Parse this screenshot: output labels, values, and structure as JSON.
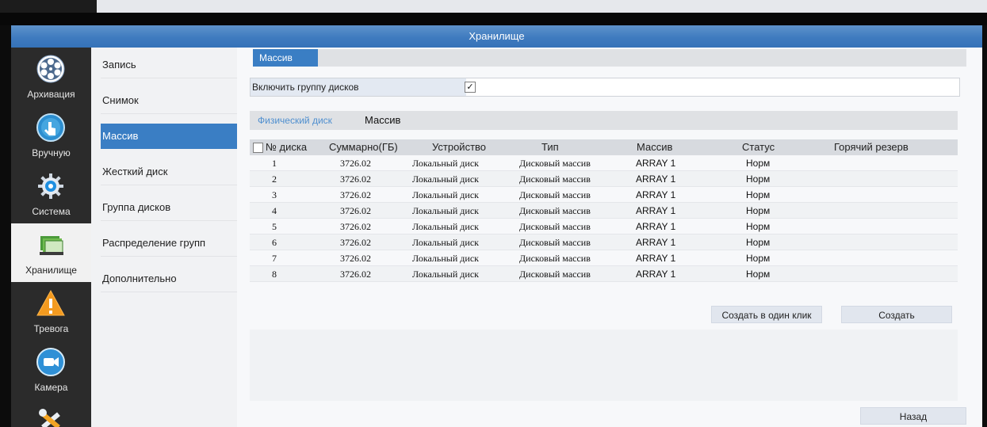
{
  "window": {
    "title": "Хранилище"
  },
  "left_nav": {
    "items": [
      {
        "id": "archive",
        "label": "Архивация",
        "icon": "film-reel-icon"
      },
      {
        "id": "manual",
        "label": "Вручную",
        "icon": "hand-pointer-icon"
      },
      {
        "id": "system",
        "label": "Система",
        "icon": "gear-icon"
      },
      {
        "id": "storage",
        "label": "Хранилище",
        "icon": "storage-folder-icon",
        "active": true
      },
      {
        "id": "alarm",
        "label": "Тревога",
        "icon": "warning-icon"
      },
      {
        "id": "camera",
        "label": "Камера",
        "icon": "camera-icon"
      },
      {
        "id": "tools",
        "label": "",
        "icon": "tools-icon"
      }
    ]
  },
  "submenu": {
    "items": [
      {
        "id": "record",
        "label": "Запись"
      },
      {
        "id": "snapshot",
        "label": "Снимок"
      },
      {
        "id": "array",
        "label": "Массив",
        "active": true
      },
      {
        "id": "hdd",
        "label": "Жесткий диск"
      },
      {
        "id": "disk-group",
        "label": "Группа дисков"
      },
      {
        "id": "group-alloc",
        "label": "Распределение групп"
      },
      {
        "id": "advanced",
        "label": "Дополнительно"
      }
    ]
  },
  "main": {
    "tab_label": "Массив",
    "enable_group_label": "Включить группу дисков",
    "enable_group_checked": true,
    "subtabs": {
      "physical": "Физический диск",
      "array": "Массив"
    },
    "table": {
      "headers": {
        "disk_no": "№ диска",
        "total": "Суммарно(ГБ)",
        "device": "Устройство",
        "type": "Тип",
        "array": "Массив",
        "status": "Статус",
        "hot_spare": "Горячий резерв"
      },
      "rows": [
        {
          "disk": "1",
          "total": "3726.02",
          "device": "Локальный диск",
          "type": "Дисковый массив",
          "array": "ARRAY 1",
          "status": "Норм"
        },
        {
          "disk": "2",
          "total": "3726.02",
          "device": "Локальный диск",
          "type": "Дисковый массив",
          "array": "ARRAY 1",
          "status": "Норм"
        },
        {
          "disk": "3",
          "total": "3726.02",
          "device": "Локальный диск",
          "type": "Дисковый массив",
          "array": "ARRAY 1",
          "status": "Норм"
        },
        {
          "disk": "4",
          "total": "3726.02",
          "device": "Локальный диск",
          "type": "Дисковый массив",
          "array": "ARRAY 1",
          "status": "Норм"
        },
        {
          "disk": "5",
          "total": "3726.02",
          "device": "Локальный диск",
          "type": "Дисковый массив",
          "array": "ARRAY 1",
          "status": "Норм"
        },
        {
          "disk": "6",
          "total": "3726.02",
          "device": "Локальный диск",
          "type": "Дисковый массив",
          "array": "ARRAY 1",
          "status": "Норм"
        },
        {
          "disk": "7",
          "total": "3726.02",
          "device": "Локальный диск",
          "type": "Дисковый массив",
          "array": "ARRAY 1",
          "status": "Норм"
        },
        {
          "disk": "8",
          "total": "3726.02",
          "device": "Локальный диск",
          "type": "Дисковый массив",
          "array": "ARRAY 1",
          "status": "Норм"
        }
      ]
    },
    "buttons": {
      "one_click_create": "Создать в один клик",
      "create": "Создать",
      "back": "Назад"
    }
  }
}
